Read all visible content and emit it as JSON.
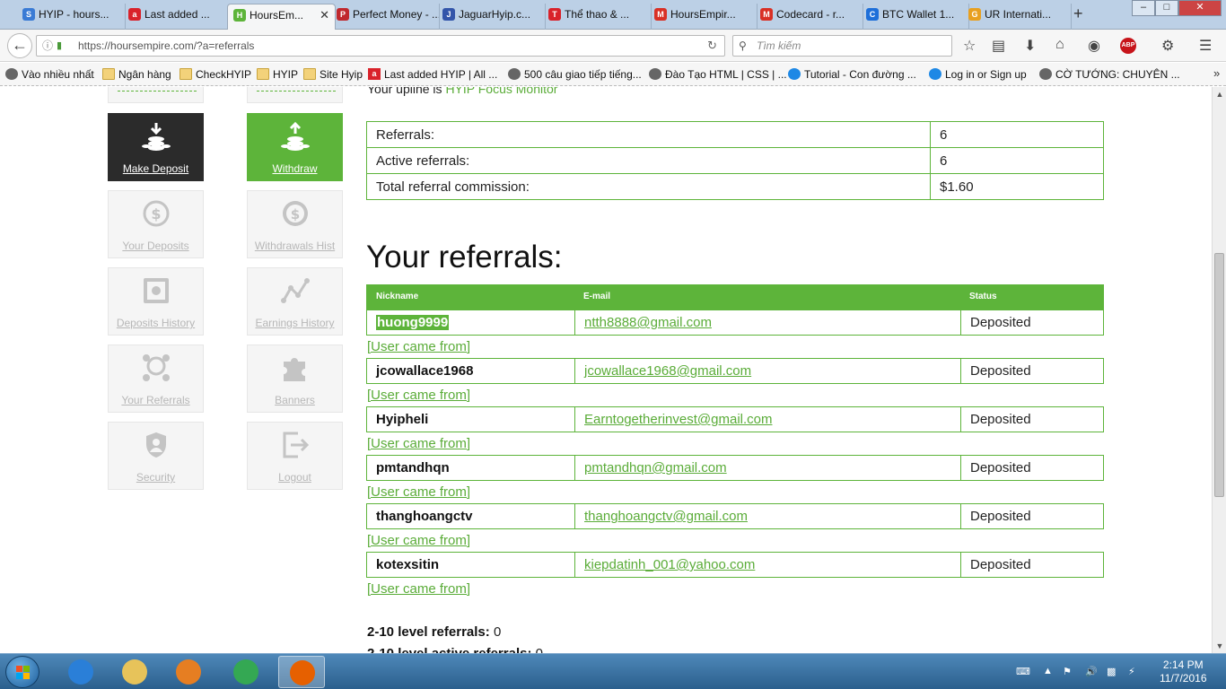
{
  "browser": {
    "tabs": [
      {
        "label": "HYIP - hours...",
        "icon_color": "#3a7bd5",
        "icon_text": "S"
      },
      {
        "label": "Last added ...",
        "icon_color": "#d9222a",
        "icon_text": "a"
      },
      {
        "label": "HoursEm...",
        "icon_color": "#5db43a",
        "icon_text": "H"
      },
      {
        "label": "Perfect Money - ...",
        "icon_color": "#c0282d",
        "icon_text": "P"
      },
      {
        "label": "JaguarHyip.c...",
        "icon_color": "#3355aa",
        "icon_text": "J"
      },
      {
        "label": "Thể thao & ...",
        "icon_color": "#d9222a",
        "icon_text": "T"
      },
      {
        "label": "HoursEmpir...",
        "icon_color": "#d93025",
        "icon_text": "M"
      },
      {
        "label": "Codecard - r...",
        "icon_color": "#d93025",
        "icon_text": "M"
      },
      {
        "label": "BTC Wallet 1...",
        "icon_color": "#1e6fd9",
        "icon_text": "C"
      },
      {
        "label": "UR Internati...",
        "icon_color": "#e8a020",
        "icon_text": "G"
      }
    ],
    "active_tab_index": 2,
    "new_tab": "+",
    "url": "https://hoursempire.com/?a=referrals",
    "search_placeholder": "Tìm kiếm",
    "bookmarks": [
      {
        "label": "Vào nhiều nhất",
        "icon": "gear-icon"
      },
      {
        "label": "Ngân hàng",
        "icon": "folder-icon"
      },
      {
        "label": "CheckHYIP",
        "icon": "folder-icon"
      },
      {
        "label": "HYIP",
        "icon": "folder-icon"
      },
      {
        "label": "Site Hyip",
        "icon": "folder-icon"
      },
      {
        "label": "Last added HYIP | All ...",
        "icon": "red-a-icon"
      },
      {
        "label": "500 câu giao tiếp tiếng...",
        "icon": "globe-icon"
      },
      {
        "label": "Đào Tạo HTML | CSS | ...",
        "icon": "globe-icon"
      },
      {
        "label": "Tutorial - Con đường ...",
        "icon": "blue-s-icon"
      },
      {
        "label": "Log in or Sign up",
        "icon": "blue-s-icon"
      },
      {
        "label": "CỜ TƯỚNG: CHUYÊN ...",
        "icon": "globe-icon"
      }
    ]
  },
  "account_menu": [
    {
      "label": "Make Deposit",
      "icon": "deposit-coins-icon",
      "style": "dark"
    },
    {
      "label": "Withdraw",
      "icon": "withdraw-coins-icon",
      "style": "green"
    },
    {
      "label": "Your Deposits",
      "icon": "dollar-cycle-icon",
      "style": "light"
    },
    {
      "label": "Withdrawals Hist",
      "icon": "dollar-coin-icon",
      "style": "light"
    },
    {
      "label": "Deposits History",
      "icon": "safe-icon",
      "style": "light"
    },
    {
      "label": "Earnings History",
      "icon": "graph-icon",
      "style": "light"
    },
    {
      "label": "Your Referrals",
      "icon": "team-icon",
      "style": "light"
    },
    {
      "label": "Banners",
      "icon": "puzzle-icon",
      "style": "light"
    },
    {
      "label": "Security",
      "icon": "shield-user-icon",
      "style": "light"
    },
    {
      "label": "Logout",
      "icon": "logout-icon",
      "style": "light"
    }
  ],
  "upline": {
    "prefix": "Your upline is",
    "name": "HYIP Focus Monitor"
  },
  "stats": [
    {
      "label": "Referrals:",
      "value": "6"
    },
    {
      "label": "Active referrals:",
      "value": "6"
    },
    {
      "label": "Total referral commission:",
      "value": "$1.60"
    }
  ],
  "referrals_title": "Your referrals:",
  "table_headers": {
    "nickname": "Nickname",
    "email": "E-mail",
    "status": "Status"
  },
  "referrals": [
    {
      "nickname": "huong9999",
      "email": "ntth8888@gmail.com",
      "status": "Deposited",
      "came_from": "[User came from]"
    },
    {
      "nickname": "jcowallace1968",
      "email": "jcowallace1968@gmail.com",
      "status": "Deposited",
      "came_from": "[User came from]"
    },
    {
      "nickname": "Hyipheli",
      "email": "Earntogetherinvest@gmail.com",
      "status": "Deposited",
      "came_from": "[User came from]"
    },
    {
      "nickname": "pmtandhqn",
      "email": "pmtandhqn@gmail.com",
      "status": "Deposited",
      "came_from": "[User came from]"
    },
    {
      "nickname": "thanghoangctv",
      "email": "thanghoangctv@gmail.com",
      "status": "Deposited",
      "came_from": "[User came from]"
    },
    {
      "nickname": "kotexsitin",
      "email": "kiepdatinh_001@yahoo.com",
      "status": "Deposited",
      "came_from": "[User came from]"
    }
  ],
  "level_referrals": {
    "label": "2-10 level referrals:",
    "value": "0"
  },
  "level_active_referrals": {
    "label": "2-10 level active referrals:",
    "value": "0"
  },
  "taskbar": {
    "apps": [
      {
        "name": "internet-explorer-icon",
        "color": "#2a7fd8"
      },
      {
        "name": "file-explorer-icon",
        "color": "#e7c35a"
      },
      {
        "name": "media-player-icon",
        "color": "#e67e22"
      },
      {
        "name": "chrome-icon",
        "color": "#34a853"
      },
      {
        "name": "firefox-icon",
        "color": "#e66000"
      }
    ],
    "time": "2:14 PM",
    "date": "11/7/2016"
  }
}
